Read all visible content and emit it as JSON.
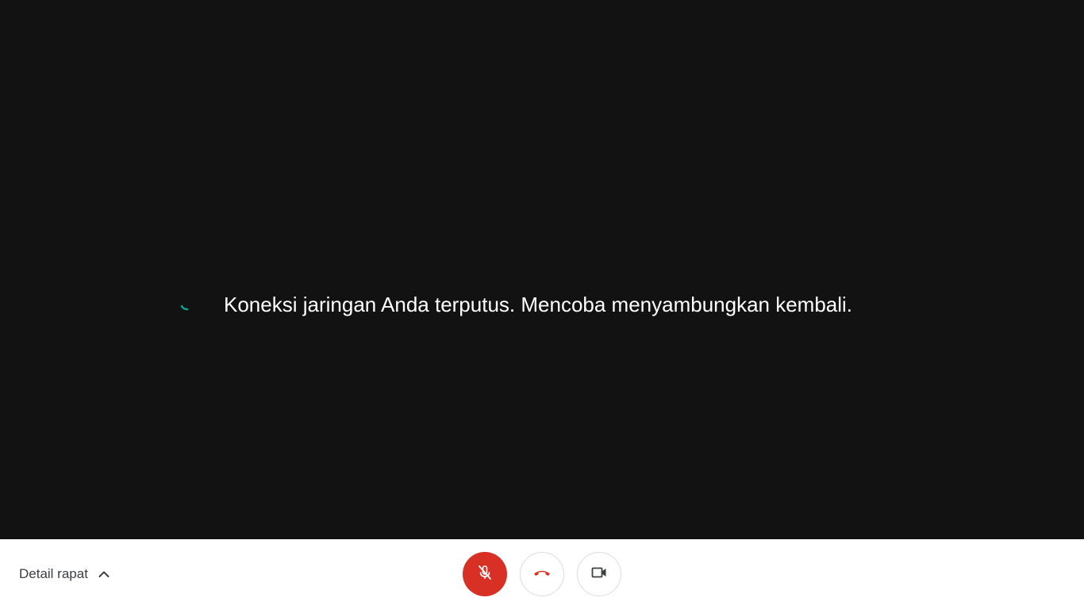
{
  "stage": {
    "reconnect_message": "Koneksi jaringan Anda terputus. Mencoba menyambungkan kembali.",
    "spinner_icon": "loading-spinner-icon",
    "spinner_color": "#0f9d8a"
  },
  "bottom_bar": {
    "details_label": "Detail rapat",
    "details_icon": "chevron-up-icon",
    "controls": {
      "microphone": {
        "icon": "mic-off-icon",
        "state": "muted",
        "color": "#d93025"
      },
      "hangup": {
        "icon": "hang-up-icon",
        "color": "#d93025"
      },
      "camera": {
        "icon": "videocam-icon",
        "state": "on"
      }
    }
  },
  "colors": {
    "stage_background": "#121212",
    "bar_background": "#ffffff",
    "danger": "#d93025",
    "text_dark": "#3c4043"
  }
}
